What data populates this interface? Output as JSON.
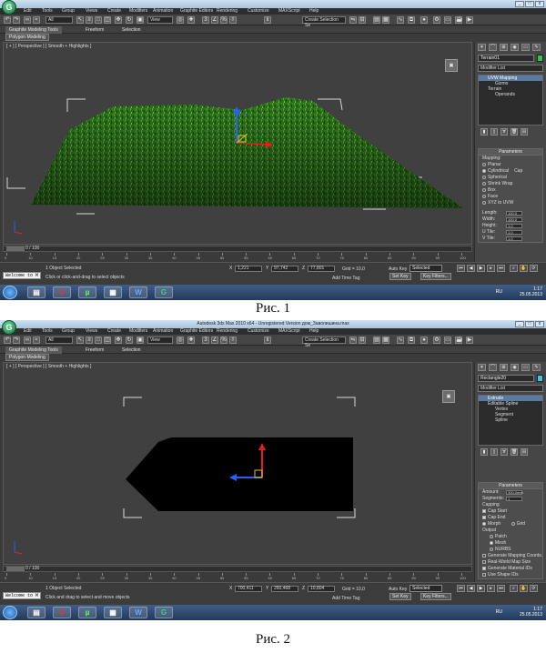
{
  "menu": [
    "Edit",
    "Tools",
    "Group",
    "Views",
    "Create",
    "Modifiers",
    "Animation",
    "Graphite Editors",
    "Rendering",
    "Customize",
    "MAXScript",
    "Help"
  ],
  "toolbar": {
    "selection_filter": "All",
    "ref_coord": "View",
    "named_selection": "Create Selection Se"
  },
  "ribbon_tabs": [
    "Graphite Modeling Tools",
    "Freeform",
    "Selection"
  ],
  "polygon_modeling": "Polygon Modeling",
  "viewport_label": "[ + ] [ Perspective ] [ Smooth + Highlights ]",
  "timeline_position": "0 / 100",
  "ruler_labels": [
    "0",
    "10",
    "15",
    "20",
    "25",
    "30",
    "35",
    "40",
    "45",
    "50",
    "55",
    "60",
    "65",
    "70",
    "75",
    "80",
    "85",
    "90",
    "95",
    "100"
  ],
  "listener": "Welcome to M",
  "add_time_tag": "Add Time Tag",
  "auto_key": "Auto Key",
  "set_key": "Set Key",
  "key_filters": "Key Filters...",
  "selected_option": "Selected",
  "clock": {
    "time": "1:17",
    "date": "25.05.2013"
  },
  "lang": "RU",
  "figure1": {
    "caption": "Рис. 1",
    "object_name": "Terrain01",
    "swatch_color": "#28c850",
    "modifier_list": "Modifier List",
    "stack": [
      {
        "label": "UVW Mapping",
        "selected": true,
        "sub": false
      },
      {
        "label": "Gizmo",
        "selected": false,
        "sub": true
      },
      {
        "label": "Terrain",
        "selected": false,
        "sub": false
      },
      {
        "label": "Operands",
        "selected": false,
        "sub": true
      }
    ],
    "rollout_title": "Parameters",
    "mapping_label": "Mapping:",
    "mapping_options": [
      {
        "label": "Planar",
        "on": false
      },
      {
        "label": "Cylindrical",
        "on": true
      },
      {
        "label": "Spherical",
        "on": false
      },
      {
        "label": "Shrink Wrap",
        "on": false
      },
      {
        "label": "Box",
        "on": false
      },
      {
        "label": "Face",
        "on": false
      },
      {
        "label": "XYZ to UVW",
        "on": false
      }
    ],
    "cap_label": "Cap",
    "fields": [
      {
        "label": "Length:",
        "value": "100,0"
      },
      {
        "label": "Width:",
        "value": "100,0"
      },
      {
        "label": "Height:",
        "value": "1,0"
      },
      {
        "label": "U Tile:",
        "value": "1,0"
      },
      {
        "label": "V Tile:",
        "value": "1,0"
      }
    ],
    "status_selected": "1 Object Selected",
    "status_prompt": "Click or click-and-drag to select objects",
    "coords": {
      "x": "1,221",
      "y": "97,742",
      "z": "77,801"
    },
    "grid": "Grid = 10,0"
  },
  "figure2": {
    "caption": "Рис. 2",
    "title": "Autodesk 3ds Max 2010 x64 - Unregistered Version  дом_Заволишина.max",
    "object_name": "Rectangle20",
    "swatch_color": "#3cc8dc",
    "modifier_list": "Modifier List",
    "stack": [
      {
        "label": "Extrude",
        "selected": true,
        "sub": false
      },
      {
        "label": "Editable Spline",
        "selected": false,
        "sub": false
      },
      {
        "label": "Vertex",
        "selected": false,
        "sub": true
      },
      {
        "label": "Segment",
        "selected": false,
        "sub": true
      },
      {
        "label": "Spline",
        "selected": false,
        "sub": true
      }
    ],
    "rollout_title": "Parameters",
    "amount_label": "Amount:",
    "amount_value": "300,0mm",
    "segments_label": "Segments:",
    "segments_value": "1",
    "capping_label": "Capping",
    "cap_start": "Cap Start",
    "cap_end": "Cap End",
    "morph": "Morph",
    "grid_opt": "Grid",
    "output_label": "Output",
    "output_options": [
      {
        "label": "Patch",
        "on": false
      },
      {
        "label": "Mesh",
        "on": true
      },
      {
        "label": "NURBS",
        "on": false
      }
    ],
    "checks": [
      {
        "label": "Generate Mapping Coords.",
        "on": false
      },
      {
        "label": "Real-World Map Size",
        "on": false
      },
      {
        "label": "Generate Material IDs",
        "on": true
      },
      {
        "label": "Use Shape IDs",
        "on": false
      }
    ],
    "status_selected": "1 Object Selected",
    "status_prompt": "Click and drag to select and move objects",
    "coords": {
      "x": "700,411",
      "y": "260,468",
      "z": "10,804"
    },
    "grid": "Grid = 10,0"
  }
}
